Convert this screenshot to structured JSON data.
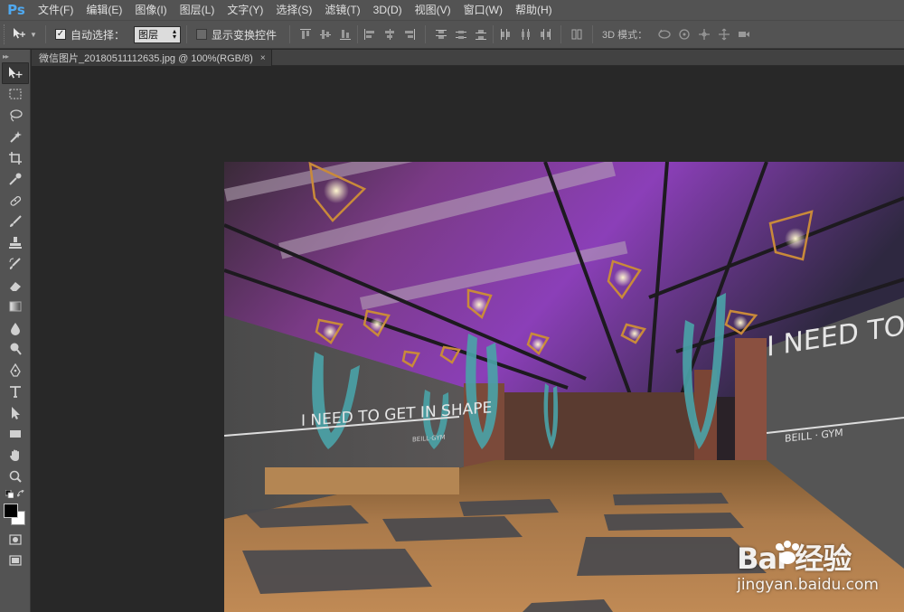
{
  "app": {
    "logo": "Ps"
  },
  "menu": [
    "文件(F)",
    "编辑(E)",
    "图像(I)",
    "图层(L)",
    "文字(Y)",
    "选择(S)",
    "滤镜(T)",
    "3D(D)",
    "视图(V)",
    "窗口(W)",
    "帮助(H)"
  ],
  "options": {
    "auto_select_label": "自动选择：",
    "auto_select_checked": true,
    "auto_select_value": "图层",
    "show_transform_label": "显示变换控件",
    "show_transform_checked": false,
    "mode_3d_label": "3D 模式："
  },
  "document": {
    "tab_title": "微信图片_20180511112635.jpg @ 100%(RGB/8)",
    "close_glyph": "×"
  },
  "image": {
    "wall_text_left": "I NEED TO GET IN SHAPE",
    "wall_sub_left": "BEILL·GYM",
    "wall_text_right": "I NEED TO GET I",
    "wall_sub_right": "BEILL · GYM"
  },
  "watermark": {
    "brand": "Bai  经验",
    "url": "jingyan.baidu.com"
  },
  "colors": {
    "accent_ps": "#4fa9f0",
    "ui_bg": "#535353",
    "canvas_bg": "#282828"
  }
}
